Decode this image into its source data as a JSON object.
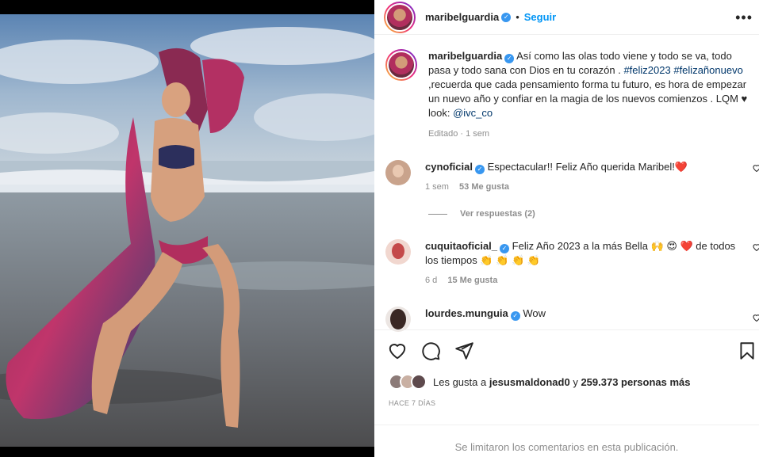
{
  "post": {
    "username": "maribelguardia",
    "follow_label": "Seguir",
    "more_label": "•••",
    "photo_alt": "Woman in a floral bikini and long sheer hooded cover-up posing on a beach at sunset",
    "caption": {
      "text_1": "Así como las olas todo viene y todo se va, todo pasa y todo sana con Dios en tu corazón . ",
      "tag_1": "#feliz2023",
      "tag_2": "#felizañonuevo",
      "text_2": " ,recuerda que cada pensamiento forma tu futuro, es hora de empezar un nuevo año y confiar en la magia de los nuevos comienzos . LQM ♥ look: ",
      "mention": "@ivc_co",
      "meta": "Editado · 1 sem"
    }
  },
  "comments": [
    {
      "user": "cynoficial",
      "text": "Espectacular!! Feliz Año querida Maribel!❤️",
      "time": "1 sem",
      "likes": "53 Me gusta",
      "avatar_color": "#c9a38c"
    },
    {
      "user": "cuquitaoficial_",
      "text": "Feliz Año 2023 a la más Bella 🙌 😍 ❤️  de todos los tiempos 👏 👏 👏 👏",
      "time": "6 d",
      "likes": "15 Me gusta",
      "avatar_color": "#c48a78"
    },
    {
      "user": "lourdes.munguia",
      "text": "Wow",
      "avatar_color": "#5a3b34"
    }
  ],
  "replies_label": "Ver respuestas (2)",
  "likes": {
    "prefix": "Les gusta a ",
    "user": "jesusmaldonad0",
    "middle": " y ",
    "count": "259.373 personas más"
  },
  "ago": "HACE 7 DÍAS",
  "comments_limited": "Se limitaron los comentarios en esta publicación.",
  "colors": {
    "accent": "#0095f6",
    "verified": "#3897f0",
    "like_heart": "#ed4956"
  }
}
